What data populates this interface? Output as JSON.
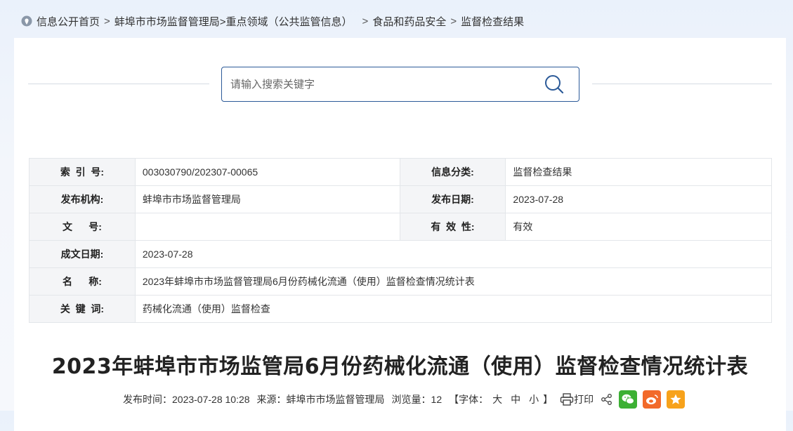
{
  "breadcrumb": {
    "items": [
      "信息公开首页",
      "蚌埠市市场监督管理局>重点领域（公共监管信息）",
      "食品和药品安全",
      "监督检查结果"
    ],
    "separator": ">"
  },
  "search": {
    "placeholder": "请输入搜索关键字",
    "icon": "search-icon"
  },
  "meta": {
    "index_label": "索  引  号:",
    "index_value": "003030790/202307-00065",
    "category_label": "信息分类:",
    "category_value": "监督检查结果",
    "publisher_label": "发布机构:",
    "publisher_value": "蚌埠市市场监督管理局",
    "pubdate_label": "发布日期:",
    "pubdate_value": "2023-07-28",
    "docno_label": "文      号:",
    "docno_value": "",
    "validity_label": "有  效  性:",
    "validity_value": "有效",
    "created_label": "成文日期:",
    "created_value": "2023-07-28",
    "name_label": "名      称:",
    "name_value": "2023年蚌埠市市场监督管理局6月份药械化流通（使用）监督检查情况统计表",
    "keyword_label": "关  键  词:",
    "keyword_value": "药械化流通（使用）监督检查"
  },
  "article": {
    "title": "2023年蚌埠市市场监管局6月份药械化流通（使用）监督检查情况统计表",
    "time_label": "发布时间：",
    "time_value": "2023-07-28 10:28",
    "source_label": "来源：",
    "source_value": "蚌埠市市场监督管理局",
    "views_label": "浏览量：",
    "views_value": "12",
    "font_open": "【字体：",
    "font_large": "大",
    "font_medium": "中",
    "font_small": "小",
    "font_close": "】",
    "print_label": "打印"
  },
  "colors": {
    "search_border": "#2c5a98",
    "wechat": "#3cb034",
    "weibo": "#f26a2a",
    "favorite": "#f7a21b"
  }
}
